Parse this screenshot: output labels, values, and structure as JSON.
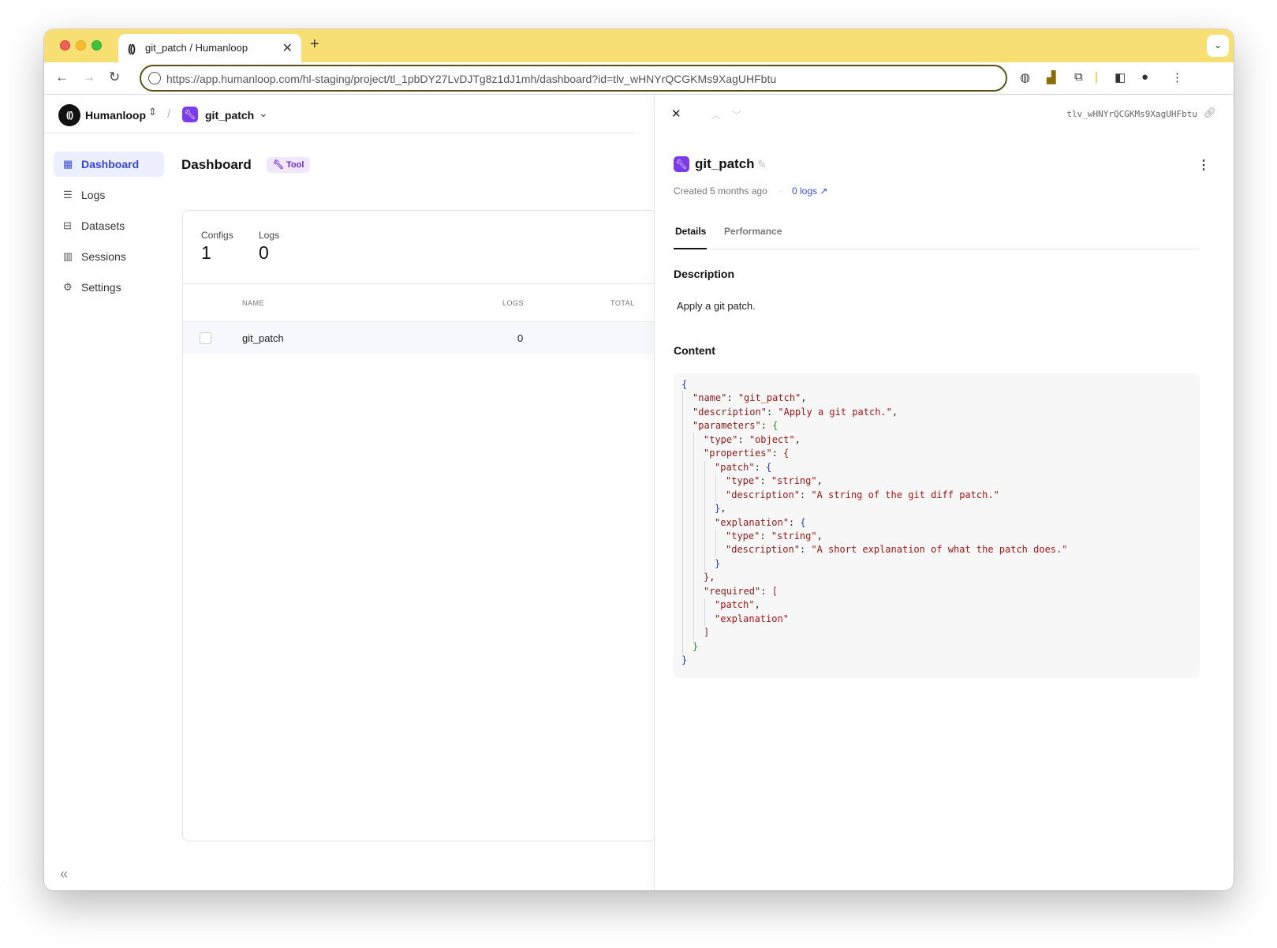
{
  "browser": {
    "tab_title": "git_patch / Humanloop",
    "tab_icon": "humanloop-logo-icon",
    "url": "https://app.humanloop.com/hl-staging/project/tl_1pbDY27LvDJTg8z1dJ1mh/dashboard?id=tlv_wHNYrQCGKMs9XagUHFbtu"
  },
  "header": {
    "org_name": "Humanloop",
    "project_name": "git_patch"
  },
  "sidebar": {
    "items": [
      {
        "label": "Dashboard",
        "icon": "grid-icon",
        "active": true
      },
      {
        "label": "Logs",
        "icon": "database-icon",
        "active": false
      },
      {
        "label": "Datasets",
        "icon": "dataset-icon",
        "active": false
      },
      {
        "label": "Sessions",
        "icon": "columns-icon",
        "active": false
      },
      {
        "label": "Settings",
        "icon": "gear-icon",
        "active": false
      }
    ]
  },
  "main": {
    "title": "Dashboard",
    "badge": "Tool",
    "stats": {
      "configs_label": "Configs",
      "configs_value": "1",
      "logs_label": "Logs",
      "logs_value": "0"
    },
    "table": {
      "headers": [
        "NAME",
        "LOGS",
        "TOTAL"
      ],
      "rows": [
        {
          "name": "git_patch",
          "logs": "0"
        }
      ]
    }
  },
  "panel": {
    "version_id": "tlv_wHNYrQCGKMs9XagUHFbtu",
    "title": "git_patch",
    "created": "Created 5 months ago",
    "logs_link": "0 logs ↗",
    "tabs": [
      {
        "label": "Details",
        "active": true
      },
      {
        "label": "Performance",
        "active": false
      }
    ],
    "description_title": "Description",
    "description": "Apply a git patch.",
    "content_title": "Content",
    "code_lines": [
      {
        "indent": 0,
        "html": "<span class=\"b1\">{</span>"
      },
      {
        "indent": 1,
        "html": "<span class=\"k\">\"name\"</span><span class=\"p\">: </span><span class=\"s\">\"git_patch\"</span><span class=\"p\">,</span>"
      },
      {
        "indent": 1,
        "html": "<span class=\"k\">\"description\"</span><span class=\"p\">: </span><span class=\"s\">\"Apply a git patch.\"</span><span class=\"p\">,</span>"
      },
      {
        "indent": 1,
        "html": "<span class=\"k\">\"parameters\"</span><span class=\"p\">: </span><span class=\"b2\">{</span>"
      },
      {
        "indent": 2,
        "html": "<span class=\"k\">\"type\"</span><span class=\"p\">: </span><span class=\"s\">\"object\"</span><span class=\"p\">,</span>"
      },
      {
        "indent": 2,
        "html": "<span class=\"k\">\"properties\"</span><span class=\"p\">: </span><span class=\"b3\">{</span>"
      },
      {
        "indent": 3,
        "html": "<span class=\"k\">\"patch\"</span><span class=\"p\">: </span><span class=\"b1\">{</span>"
      },
      {
        "indent": 4,
        "html": "<span class=\"k\">\"type\"</span><span class=\"p\">: </span><span class=\"s\">\"string\"</span><span class=\"p\">,</span>"
      },
      {
        "indent": 4,
        "html": "<span class=\"k\">\"description\"</span><span class=\"p\">: </span><span class=\"s\">\"A string of the git diff patch.\"</span>"
      },
      {
        "indent": 3,
        "html": "<span class=\"b1\">}</span><span class=\"p\">,</span>"
      },
      {
        "indent": 3,
        "html": "<span class=\"k\">\"explanation\"</span><span class=\"p\">: </span><span class=\"b1\">{</span>"
      },
      {
        "indent": 4,
        "html": "<span class=\"k\">\"type\"</span><span class=\"p\">: </span><span class=\"s\">\"string\"</span><span class=\"p\">,</span>"
      },
      {
        "indent": 4,
        "html": "<span class=\"k\">\"description\"</span><span class=\"p\">: </span><span class=\"s\">\"A short explanation of what the patch does.\"</span>"
      },
      {
        "indent": 3,
        "html": "<span class=\"b1\">}</span>"
      },
      {
        "indent": 2,
        "html": "<span class=\"b3\">}</span><span class=\"p\">,</span>"
      },
      {
        "indent": 2,
        "html": "<span class=\"k\">\"required\"</span><span class=\"p\">: </span><span class=\"b3\">[</span>"
      },
      {
        "indent": 3,
        "html": "<span class=\"s\">\"patch\"</span><span class=\"p\">,</span>"
      },
      {
        "indent": 3,
        "html": "<span class=\"s\">\"explanation\"</span>"
      },
      {
        "indent": 2,
        "html": "<span class=\"b3\">]</span>"
      },
      {
        "indent": 1,
        "html": "<span class=\"b2\">}</span>"
      },
      {
        "indent": 0,
        "html": "<span class=\"b1\">}</span>"
      }
    ]
  }
}
